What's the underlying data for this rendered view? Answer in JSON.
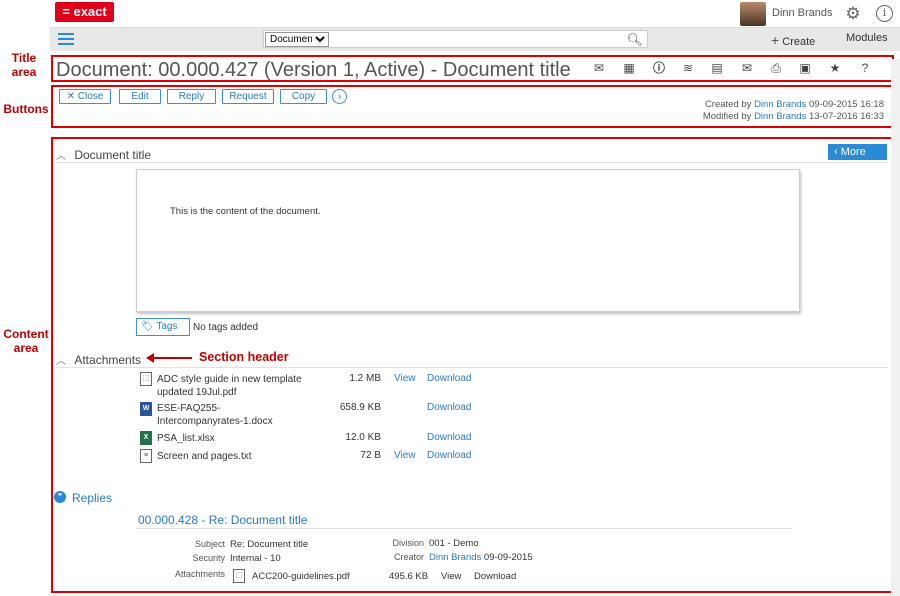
{
  "header": {
    "logo": "= exact",
    "username": "Dinn Brands"
  },
  "nav": {
    "search_select": "Document",
    "create_label": "Create",
    "modules_label": "Modules"
  },
  "annotations": {
    "title_area": "Title area",
    "buttons": "Buttons",
    "content_area": "Content area",
    "section_header": "Section header"
  },
  "title": "Document: 00.000.427 (Version 1, Active) - Document title",
  "title_icons": [
    "inbox-icon",
    "calculator-icon",
    "info-icon",
    "database-icon",
    "document-link-icon",
    "email-icon",
    "print-icon",
    "report-icon",
    "star-icon",
    "help-icon"
  ],
  "buttons": {
    "close": "Close",
    "edit": "Edit",
    "reply": "Reply",
    "request": "Request",
    "copy": "Copy"
  },
  "meta": {
    "created_prefix": "Created by",
    "created_by": "Dinn Brands",
    "created_date": "09-09-2015 16:18",
    "modified_prefix": "Modified by",
    "modified_by": "Dinn Brands",
    "modified_date": "13-07-2016 16:33"
  },
  "document": {
    "section_title": "Document title",
    "more_label": "More",
    "content": "This is the content of the document.",
    "tags_label": "Tags",
    "no_tags": "No tags added"
  },
  "attachments": {
    "section_title": "Attachments",
    "items": [
      {
        "name_line1": "ADC style guide in new template",
        "name_line2": "updated 19Jul.pdf",
        "size": "1.2 MB",
        "view": "View",
        "download": "Download",
        "type": "pdf"
      },
      {
        "name_line1": "ESE-FAQ255-",
        "name_line2": "Intercompanyrates-1.docx",
        "size": "658.9 KB",
        "view": "",
        "download": "Download",
        "type": "word"
      },
      {
        "name_line1": "PSA_list.xlsx",
        "name_line2": "",
        "size": "12.0 KB",
        "view": "",
        "download": "Download",
        "type": "excel"
      },
      {
        "name_line1": "Screen and pages.txt",
        "name_line2": "",
        "size": "72 B",
        "view": "View",
        "download": "Download",
        "type": "txt"
      }
    ]
  },
  "replies": {
    "section_title": "Replies",
    "reply_title": "00.000.428 - Re: Document title",
    "subject_label": "Subject",
    "subject_value": "Re: Document title",
    "security_label": "Security",
    "security_value": "Internal - 10",
    "division_label": "Division",
    "division_value": "001 - Demo",
    "creator_label": "Creator",
    "creator_name": "Dinn Brands",
    "creator_date": "09-09-2015",
    "attachments_label": "Attachments",
    "attachment_name": "ACC200-guidelines.pdf",
    "attachment_size": "495.6 KB",
    "attachment_view": "View",
    "attachment_download": "Download"
  },
  "colors": {
    "brand_red": "#e1001a",
    "link_blue": "#2a7ac4",
    "annotation_red": "#c00000"
  }
}
